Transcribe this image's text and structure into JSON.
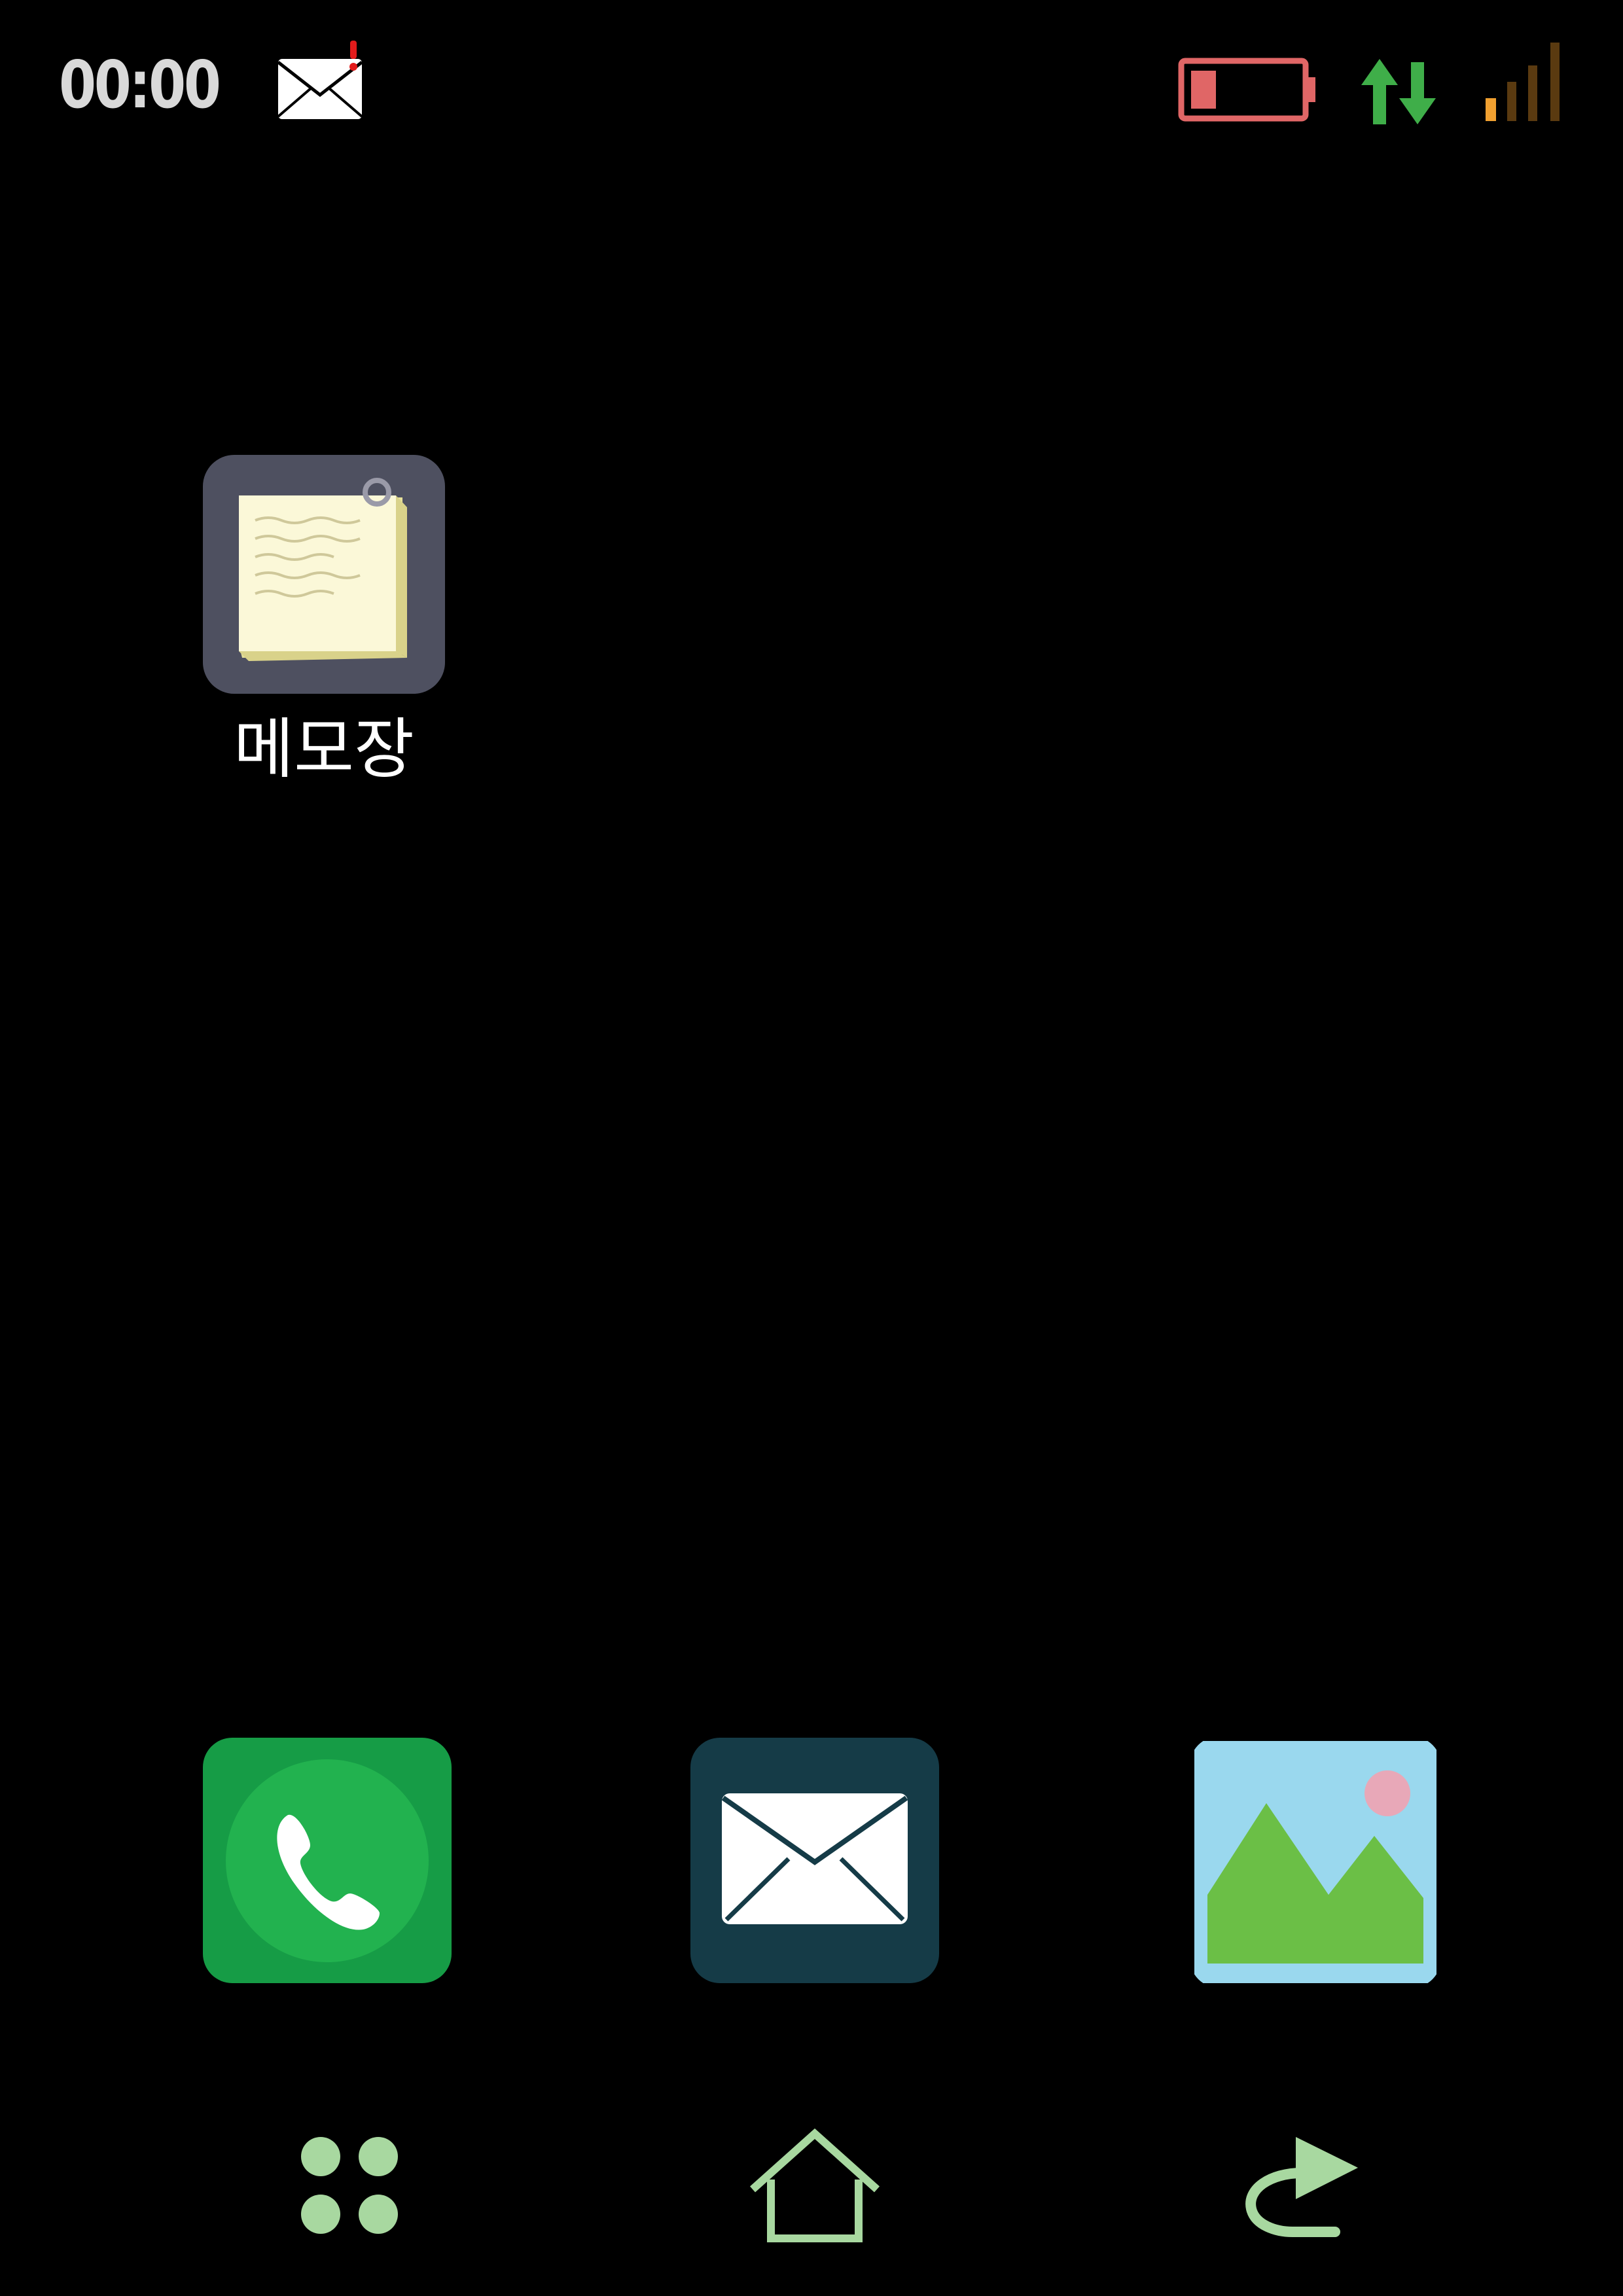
{
  "status_bar": {
    "time": "00:00",
    "icons": [
      "mail-notification-icon",
      "battery-low-icon",
      "data-transfer-icon",
      "signal-strength-icon"
    ]
  },
  "desktop": {
    "apps": [
      {
        "name": "memo",
        "label": "메모장",
        "icon": "notepad-icon"
      }
    ]
  },
  "dock": {
    "apps": [
      {
        "icon": "phone-icon"
      },
      {
        "icon": "mail-icon"
      },
      {
        "icon": "gallery-icon"
      }
    ]
  },
  "nav_bar": {
    "icons": [
      "app-drawer-icon",
      "home-icon",
      "back-icon"
    ]
  },
  "colors": {
    "background": "#000000",
    "battery": "#e06666",
    "data_arrows": "#3fae49",
    "signal_active": "#f0a030",
    "signal_inactive": "#5a3a10",
    "nav_icons": "#a8d8a0",
    "phone_bg": "#169c46",
    "mail_bg": "#153b47",
    "gallery_sky": "#9ad8ee",
    "gallery_hills": "#6bbf46"
  }
}
